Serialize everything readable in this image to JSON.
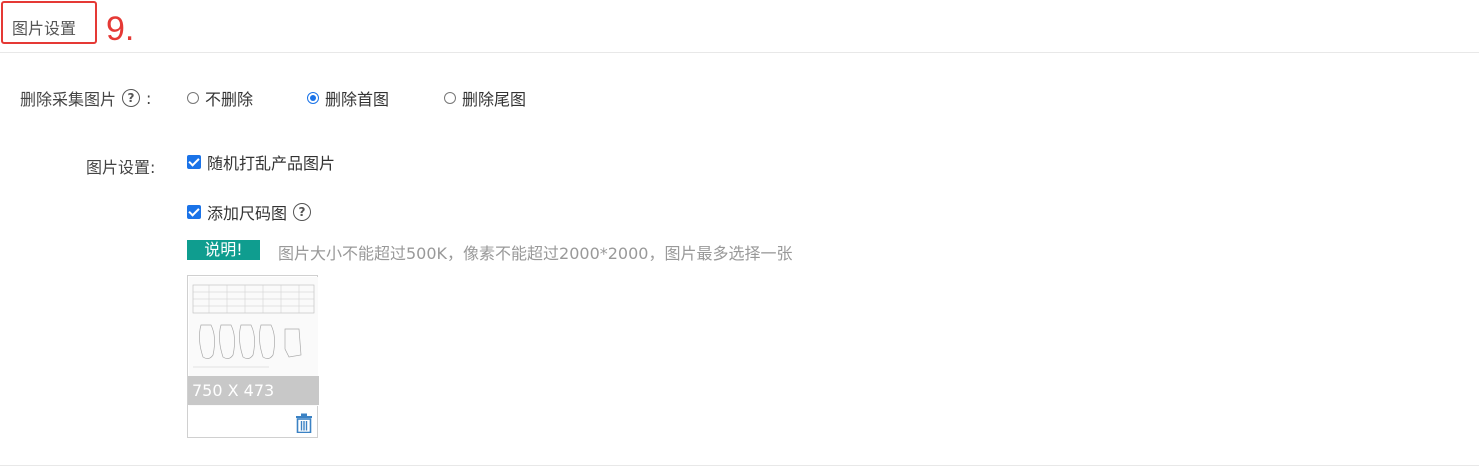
{
  "header": {
    "title": "图片设置",
    "step": "9."
  },
  "delete_images": {
    "label": "删除采集图片",
    "colon": ":",
    "options": [
      {
        "label": "不删除",
        "checked": false
      },
      {
        "label": "删除首图",
        "checked": true
      },
      {
        "label": "删除尾图",
        "checked": false
      }
    ]
  },
  "image_settings": {
    "label": "图片设置:",
    "shuffle": {
      "label": "随机打乱产品图片",
      "checked": true
    },
    "size_chart": {
      "label": "添加尺码图",
      "checked": true
    },
    "note_badge": "说明!",
    "note_text": "图片大小不能超过500K，像素不能超过2000*2000，图片最多选择一张",
    "thumbnail": {
      "caption": "750 X 473"
    }
  },
  "colors": {
    "accent": "#1a73e8",
    "badge": "#0f9d8f",
    "step_red": "#e53935"
  }
}
